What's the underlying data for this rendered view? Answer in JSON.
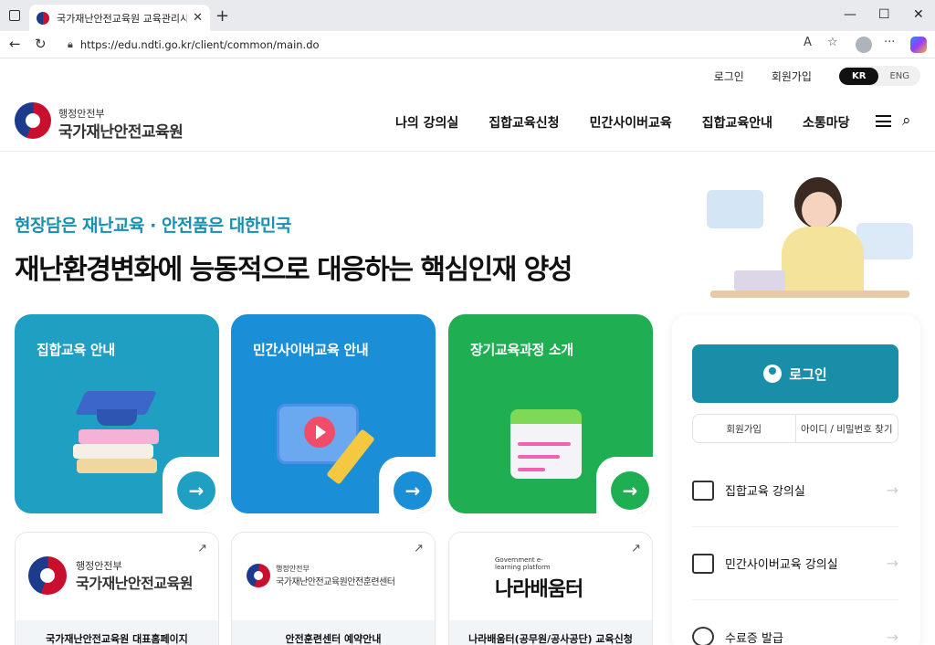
{
  "browser": {
    "tab_title": "국가재난안전교육원 교육관리시스템",
    "tab_close": "✕",
    "new_tab": "+",
    "url": "https://edu.ndti.go.kr/client/common/main.do",
    "window_controls": [
      "—",
      "☐",
      "✕"
    ],
    "more": "···"
  },
  "util": {
    "login": "로그인",
    "join": "회원가입",
    "lang_kr": "KR",
    "lang_en": "ENG"
  },
  "logo": {
    "sub": "행정안전부",
    "main": "국가재난안전교육원"
  },
  "gnb": [
    "나의 강의실",
    "집합교육신청",
    "민간사이버교육",
    "집합교육안내",
    "소통마당"
  ],
  "hero": {
    "subtitle": "현장담은 재난교육 · 안전품은 대한민국",
    "title": "재난환경변화에 능동적으로 대응하는 핵심인재 양성"
  },
  "cards": [
    {
      "title": "집합교육 안내",
      "color": "#1f9fc2",
      "icon": "graduation-cap-books-icon"
    },
    {
      "title": "민간사이버교육 안내",
      "color": "#1a8fd8",
      "icon": "video-play-pencil-icon"
    },
    {
      "title": "장기교육과정 소개",
      "color": "#1fae52",
      "icon": "calendar-icon"
    }
  ],
  "card_arrow": "→",
  "link_cards": [
    {
      "logo_sub": "행정안전부",
      "logo_main": "국가재난안전교육원",
      "label": "국가재난안전교육원 대표홈페이지"
    },
    {
      "logo_sub": "행정안전부",
      "logo_main": "국가재난안전교육원안전훈련센터",
      "label": "안전훈련센터 예약안내"
    },
    {
      "logo_sub": "Government e-learning platform",
      "logo_main": "나라배움터",
      "label": "나라배움터(공무원/공사공단) 교육신청"
    }
  ],
  "ext_icon": "↗",
  "panel": {
    "login": "로그인",
    "join": "회원가입",
    "find": "아이디 / 비밀번호 찾기",
    "links": [
      {
        "label": "집합교육 강의실",
        "icon": "classroom-icon"
      },
      {
        "label": "민간사이버교육 강의실",
        "icon": "monitor-icon"
      },
      {
        "label": "수료증 발급",
        "icon": "certificate-icon"
      }
    ],
    "arrow": "→"
  }
}
